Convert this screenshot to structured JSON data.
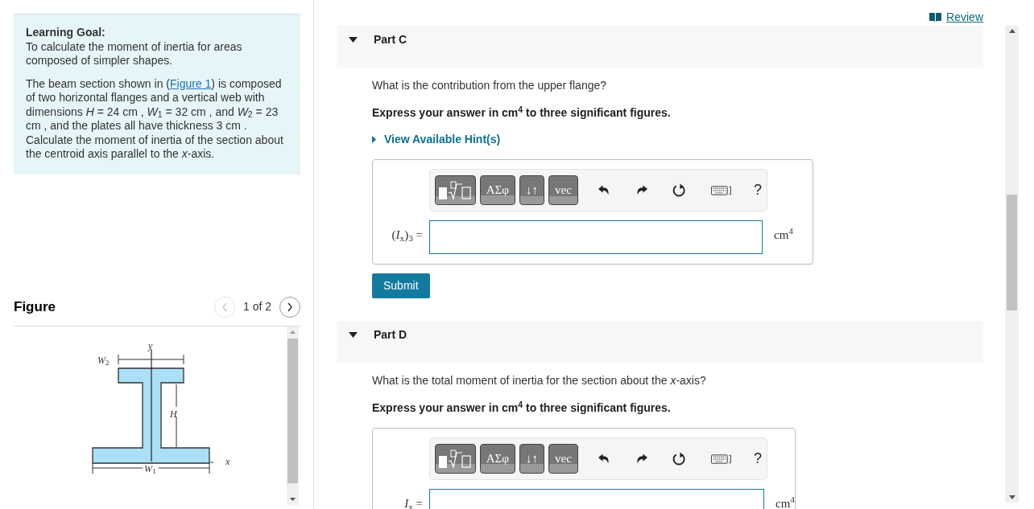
{
  "learning_goal": {
    "title": "Learning Goal:",
    "text": "To calculate the moment of inertia for areas composed of simpler shapes.",
    "intro_before": "The beam section shown in (",
    "figure_link": "Figure 1",
    "intro_after": ") is composed of two horizontal flanges and a vertical web with dimensions *H* = 24 cm , *W*$_{1}$ = 32 cm , and *W*$_{2}$ = 23 cm , and the plates all have thickness 3 cm . Calculate the moment of inertia of the section about the centroid axis parallel to the *x*-axis."
  },
  "figure": {
    "title": "Figure",
    "pager": "1 of 2",
    "prev_disabled": true,
    "next_disabled": false,
    "labels": {
      "y": "y",
      "w2": "W",
      "w2_sub": "2",
      "h": "H",
      "x": "x",
      "w1": "W",
      "w1_sub": "1"
    }
  },
  "review_link": "Review",
  "parts": [
    {
      "title": "Part C",
      "expanded": true,
      "question": "What is the contribution from the upper flange?",
      "instruction": "Express your answer in cm$^{4}$ to three significant figures.",
      "hint": "View Available Hint(s)",
      "toolbar": [
        {
          "kind": "template"
        },
        {
          "kind": "label",
          "label": "ΑΣφ"
        },
        {
          "kind": "label",
          "label": "↓↑"
        },
        {
          "kind": "label",
          "label": "vec"
        },
        {
          "kind": "undo"
        },
        {
          "kind": "redo"
        },
        {
          "kind": "reset"
        },
        {
          "kind": "keyboard"
        },
        {
          "kind": "help",
          "label": "?"
        }
      ],
      "answer_label": "(*I*$_{x}$)$_{3}$ =",
      "unit": "cm$^{4}$",
      "submit": "Submit"
    },
    {
      "title": "Part D",
      "expanded": true,
      "question": "What is the total moment of inertia for the section about the *x*-axis?",
      "instruction": "Express your answer in cm$^{4}$ to three significant figures.",
      "toolbar": [
        {
          "kind": "template"
        },
        {
          "kind": "label",
          "label": "ΑΣφ"
        },
        {
          "kind": "label",
          "label": "↓↑"
        },
        {
          "kind": "label",
          "label": "vec"
        },
        {
          "kind": "undo"
        },
        {
          "kind": "redo"
        },
        {
          "kind": "reset"
        },
        {
          "kind": "keyboard"
        },
        {
          "kind": "help",
          "label": "?"
        }
      ],
      "answer_label": "*I*$_{x}$ =",
      "unit": "cm$^{4}$"
    }
  ]
}
